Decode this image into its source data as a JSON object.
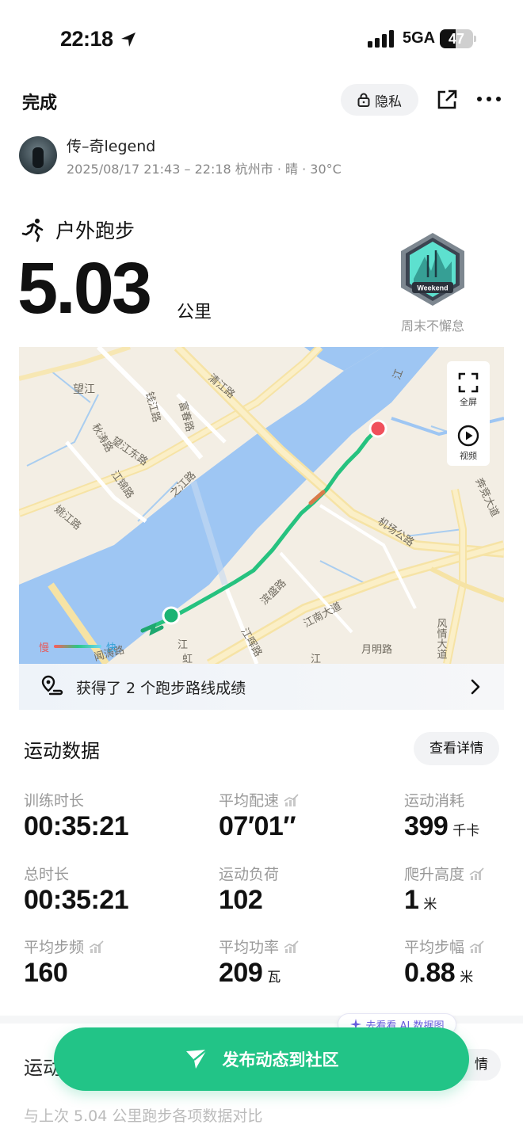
{
  "status_bar": {
    "time": "22:18",
    "network": "5GA",
    "battery": "47",
    "battery_level": 0.47
  },
  "topbar": {
    "done_label": "完成",
    "privacy_label": "隐私"
  },
  "user": {
    "name": "传–奇legend",
    "meta": "2025/08/17 21:43 – 22:18 杭州市 · 晴 · 30°C"
  },
  "activity": {
    "type": "户外跑步",
    "distance": "5.03",
    "distance_unit": "公里"
  },
  "badge": {
    "name": "Weekend",
    "label": "周末不懈怠"
  },
  "map": {
    "tools": {
      "fullscreen": "全屏",
      "video": "视频"
    },
    "legend": {
      "slow": "慢",
      "fast": "快"
    },
    "labels": {
      "wangjiang": "望江",
      "qiutao": "秋涛路",
      "qianjiang": "钱江路",
      "fuxing": "富春路",
      "wangjiangdong": "望江东路",
      "jiangjin": "江锦路",
      "zhijiang": "之江路",
      "qingjiang": "清江路",
      "yaojiang": "姚江路",
      "jichang": "机场公路",
      "binsheng": "滨盛路",
      "jiangnan": "江南大道",
      "jiangbin": "江晖路",
      "yueming": "月明路",
      "fengqing": "风情大道",
      "minhe": "闻涛路",
      "jiangkou": "江",
      "wenyan": "闻涛路",
      "ganxi": "奔竞大道",
      "shuitai": "江",
      "hong": "虹",
      "jiang2": "江",
      "dong": "江"
    }
  },
  "achievement": {
    "text": "获得了 2 个跑步路线成绩"
  },
  "data_section": {
    "title": "运动数据",
    "detail_button": "查看详情"
  },
  "metrics": [
    {
      "label": "训练时长",
      "value": "00:35:21",
      "unit": "",
      "trend": false
    },
    {
      "label": "平均配速",
      "value": "07′01″",
      "unit": "",
      "trend": true
    },
    {
      "label": "运动消耗",
      "value": "399",
      "unit": "千卡",
      "trend": false
    },
    {
      "label": "总时长",
      "value": "00:35:21",
      "unit": "",
      "trend": false
    },
    {
      "label": "运动负荷",
      "value": "102",
      "unit": "",
      "trend": false
    },
    {
      "label": "爬升高度",
      "value": "1",
      "unit": "米",
      "trend": true
    },
    {
      "label": "平均步频",
      "value": "160",
      "unit": "",
      "trend": true
    },
    {
      "label": "平均功率",
      "value": "209",
      "unit": "瓦",
      "trend": true
    },
    {
      "label": "平均步幅",
      "value": "0.88",
      "unit": "米",
      "trend": true
    }
  ],
  "ai_chip": {
    "label": "去看看 AI 数据图"
  },
  "publish": {
    "label": "发布动态到社区"
  },
  "bottom": {
    "title": "运动",
    "right_button": "情",
    "compare_text": "与上次 5.04 公里跑步各项数据对比"
  },
  "colors": {
    "accent": "#22c487",
    "route": "#26c27f",
    "start": "#1bb374",
    "end": "#f0505c",
    "river": "#9ec6f3"
  }
}
